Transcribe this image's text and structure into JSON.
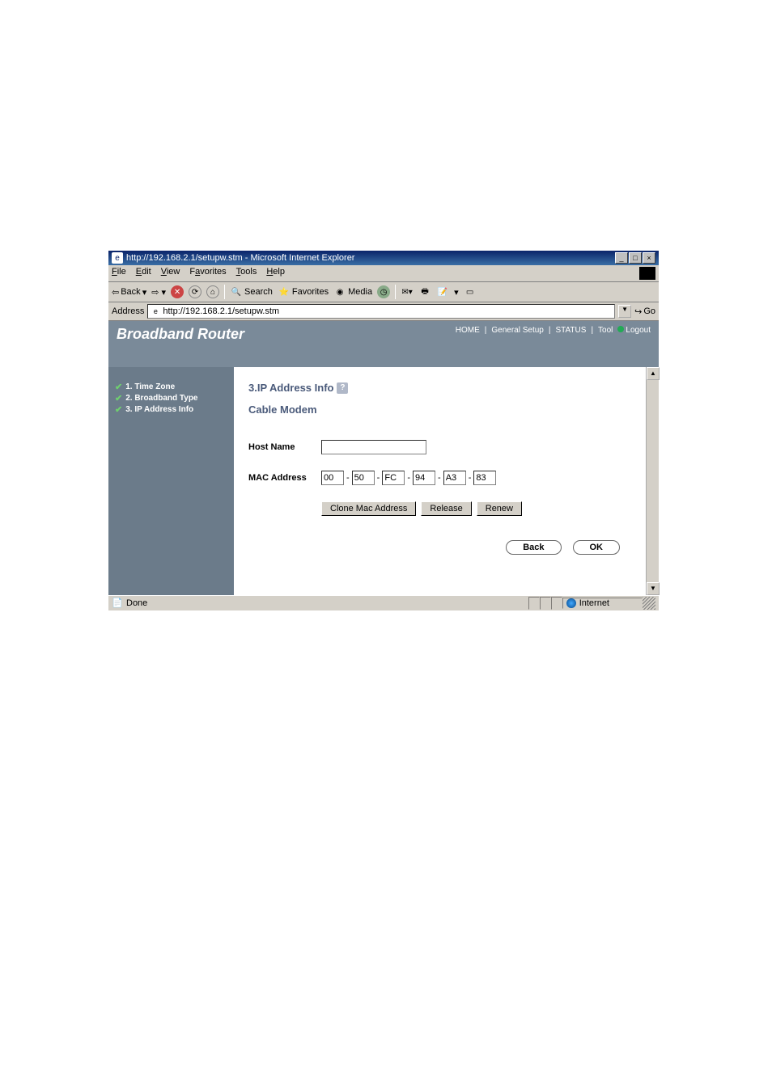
{
  "window": {
    "title": "http://192.168.2.1/setupw.stm - Microsoft Internet Explorer"
  },
  "menubar": {
    "file": "File",
    "edit": "Edit",
    "view": "View",
    "favorites": "Favorites",
    "tools": "Tools",
    "help": "Help"
  },
  "toolbar": {
    "back": "Back",
    "search": "Search",
    "favorites": "Favorites",
    "media": "Media"
  },
  "addressbar": {
    "label": "Address",
    "url": "http://192.168.2.1/setupw.stm",
    "go": "Go"
  },
  "brand": "Broadband Router",
  "nav": {
    "home": "HOME",
    "general": "General Setup",
    "status": "STATUS",
    "tool": "Tool",
    "logout": "Logout"
  },
  "sidebar": {
    "items": [
      {
        "label": "1. Time Zone"
      },
      {
        "label": "2. Broadband Type"
      },
      {
        "label": "3. IP Address Info"
      }
    ]
  },
  "main": {
    "heading": "3.IP Address Info",
    "subtitle": "Cable Modem",
    "host_label": "Host Name",
    "host_value": "",
    "mac_label": "MAC Address",
    "mac": [
      "00",
      "50",
      "FC",
      "94",
      "A3",
      "83"
    ],
    "clone": "Clone Mac Address",
    "release": "Release",
    "renew": "Renew",
    "back": "Back",
    "ok": "OK"
  },
  "statusbar": {
    "text": "Done",
    "zone": "Internet"
  }
}
